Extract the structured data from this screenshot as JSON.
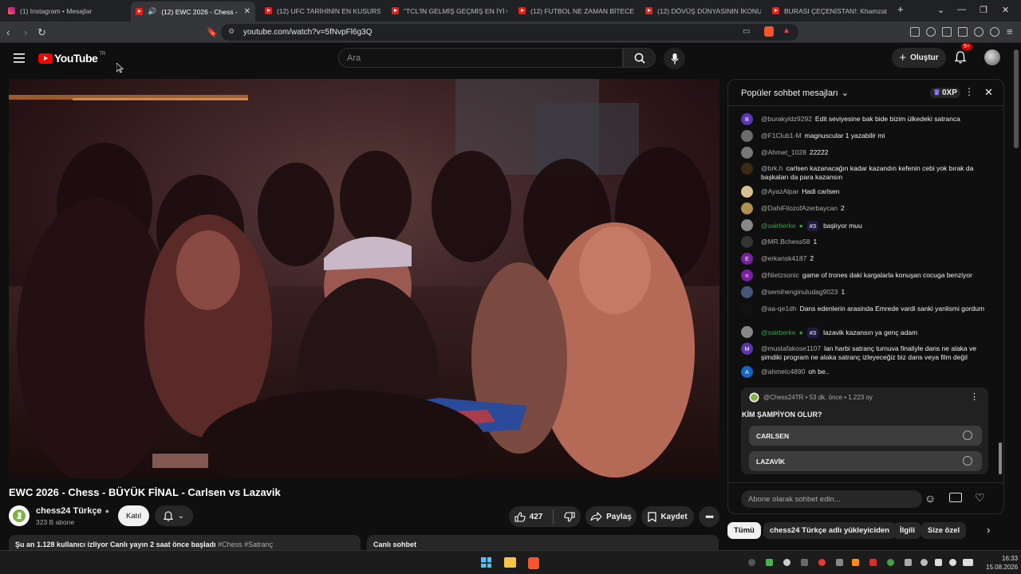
{
  "browser": {
    "tabs": [
      {
        "label": "(1) Instagram • Mesajlar",
        "icon": "instagram-icon"
      },
      {
        "label": "(12) EWC 2026 - Chess - BÜY",
        "icon": "youtube-icon",
        "active": true
      },
      {
        "label": "(12) UFC TARİHİNİN EN KUSURSUZ",
        "icon": "youtube-icon"
      },
      {
        "label": "\"TCL'İN GELMİŞ GEÇMİŞ EN İYİ ORT",
        "icon": "youtube-icon"
      },
      {
        "label": "(12) FUTBOL NE ZAMAN BİTECEK?",
        "icon": "youtube-icon"
      },
      {
        "label": "(12) DÖVÜŞ DÜNYASININ İKONU: C",
        "icon": "youtube-icon"
      },
      {
        "label": "BURASI ÇEÇENİSTAN!: Khamzat Chi",
        "icon": "youtube-icon"
      }
    ],
    "new_tab": "+",
    "url": "youtube.com/watch?v=5fNvpFl6g3Q"
  },
  "youtube": {
    "logo_text": "YouTube",
    "country_code": "TR",
    "search_placeholder": "Ara",
    "create_label": "Oluştur",
    "notifications_badge": "9+"
  },
  "video": {
    "title": "EWC 2026 - Chess - BÜYÜK FİNAL - Carlsen vs Lazavik",
    "channel": "chess24 Türkçe",
    "subscribers": "323 B abone",
    "join_label": "Katıl",
    "likes": "427",
    "share_label": "Paylaş",
    "save_label": "Kaydet",
    "viewers_line": "Şu an 1.128 kullanıcı izliyor  Canlı yayın 2 saat önce başladı",
    "tags": "#Chess #Satranç",
    "live_chat_label": "Canlı sohbet"
  },
  "chat": {
    "header_title": "Popüler sohbet mesajları",
    "xp": "0XP",
    "messages": [
      {
        "avatar_letter": "B",
        "avatar_color": "#5e35b1",
        "author": "@burakyldz9292",
        "text": "Edit seviyesine bak bide bizim ülkedeki satranca"
      },
      {
        "avatar_letter": "",
        "avatar_color": "#6b6b6b",
        "author": "@F1Club1-M",
        "text": "magnuscular 1 yazabilir mi"
      },
      {
        "avatar_letter": "",
        "avatar_color": "#777",
        "author": "@Ahmet_1028",
        "text": "22222"
      },
      {
        "avatar_letter": "",
        "avatar_color": "#3a2a10",
        "author": "@brk.h",
        "text": "carlsen kazanacağın kadar kazandın kefenin cebi yok bırak da başkaları da para kazansın"
      },
      {
        "avatar_letter": "",
        "avatar_color": "#d8c090",
        "author": "@AyazAlpar",
        "text": "Hadi carlsen"
      },
      {
        "avatar_letter": "",
        "avatar_color": "#b09050",
        "author": "@DahiFilozofAzerbaycan",
        "text": "2"
      },
      {
        "avatar_letter": "",
        "avatar_color": "#888",
        "author": "@sairberke",
        "text": "başlıyor muu",
        "verified": true,
        "badge": "#3"
      },
      {
        "avatar_letter": "",
        "avatar_color": "#333",
        "author": "@MR.Bchess58",
        "text": "1"
      },
      {
        "avatar_letter": "E",
        "avatar_color": "#7b1fa2",
        "author": "@erkansk4187",
        "text": "2"
      },
      {
        "avatar_letter": "n",
        "avatar_color": "#7b1fa2",
        "author": "@Nietzsonic",
        "text": "game of trones daki kargalarla konuşan cocuga benziyor"
      },
      {
        "avatar_letter": "",
        "avatar_color": "#445577",
        "author": "@semihenginuludag9023",
        "text": "1"
      },
      {
        "avatar_letter": "",
        "avatar_color": "#111",
        "author": "@aa-qe1dh",
        "text": "Dans edenlerin arasinda Emrede vardi sanki yanlismi gordum"
      },
      {
        "avatar_letter": "",
        "avatar_color": "#888",
        "author": "@sairberke",
        "text": "lazavik kazansın ya genç adam",
        "verified": true,
        "badge": "#3"
      },
      {
        "avatar_letter": "M",
        "avatar_color": "#5e35b1",
        "author": "@mustafakose1107",
        "text": "lan harbi satranç turnuva finaliyle dans ne alaka ve şimdiki program ne alaka satranç izleyeceğiz biz dans veya film değil"
      },
      {
        "avatar_letter": "A",
        "avatar_color": "#1565c0",
        "author": "@ahmetc4890",
        "text": "oh be.."
      }
    ],
    "poll": {
      "author_line": "@Chess24TR • 53 dk. önce • 1.223 oy",
      "question": "KİM ŞAMPİYON OLUR?",
      "options": [
        "CARLSEN",
        "LAZAVİK"
      ]
    },
    "input_placeholder": "Abone olarak sohbet edin..."
  },
  "chips": [
    "Tümü",
    "chess24 Türkçe adlı yükleyiciden",
    "İlgili",
    "Size özel"
  ],
  "taskbar": {
    "time": "16:33",
    "date": "15.08.2026"
  }
}
